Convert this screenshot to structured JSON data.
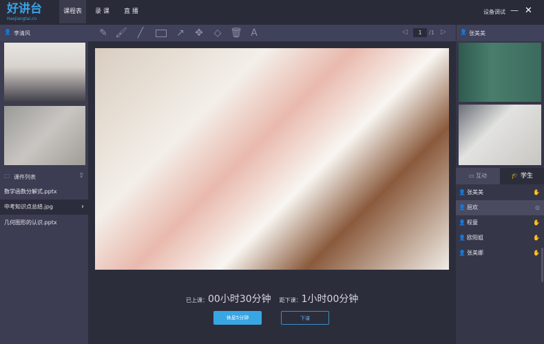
{
  "app": {
    "logo_text": "好讲台",
    "logo_sub": "Haojiangtai.cn"
  },
  "nav": [
    {
      "label": "课程表",
      "active": true
    },
    {
      "label": "录 课"
    },
    {
      "label": "直 播"
    }
  ],
  "window": {
    "device_test": "设备调试",
    "minimize": "—",
    "close": "✕"
  },
  "teacher": {
    "name": "李清风"
  },
  "toolbar": {
    "tools": [
      "pencil-icon",
      "brush-icon",
      "line-icon",
      "rectangle-icon",
      "arrow-icon",
      "move-icon",
      "eraser-icon",
      "trash-icon",
      "text-icon"
    ],
    "page_current": "1",
    "page_total": "/1"
  },
  "courseware": {
    "title": "课件列表",
    "files": [
      {
        "name": "数学函数分解式.pptx"
      },
      {
        "name": "中考知识点总结.jpg",
        "selected": true
      },
      {
        "name": "几何图形的认识.pptx"
      }
    ]
  },
  "student_view": {
    "name": "张美美"
  },
  "tabs": [
    {
      "label": "互动"
    },
    {
      "label": "学生",
      "active": true
    }
  ],
  "students": [
    {
      "name": "张美美"
    },
    {
      "name": "屈欢",
      "selected": true
    },
    {
      "name": "程童"
    },
    {
      "name": "欧阳姐"
    },
    {
      "name": "张美娜"
    }
  ],
  "timer": {
    "elapsed_label": "已上课：",
    "elapsed": "00小时30分钟",
    "remain_label": "距下课：",
    "remain": "1小时00分钟"
  },
  "buttons": {
    "break": "休息5分钟",
    "end": "下课"
  },
  "colors": {
    "accent": "#3aa4e6"
  }
}
